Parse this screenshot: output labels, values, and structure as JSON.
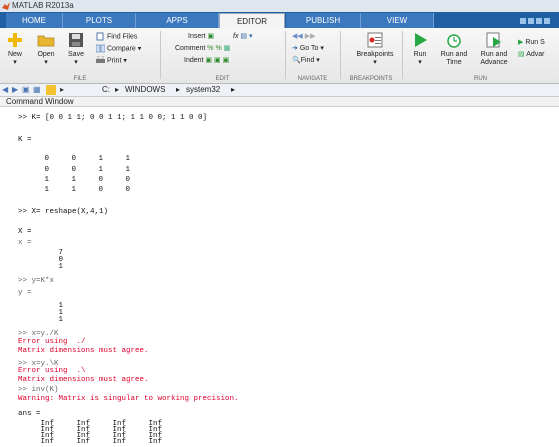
{
  "window": {
    "title": "MATLAB R2013a"
  },
  "tabs": [
    {
      "label": "HOME"
    },
    {
      "label": "PLOTS"
    },
    {
      "label": "APPS"
    },
    {
      "label": "EDITOR"
    },
    {
      "label": "PUBLISH"
    },
    {
      "label": "VIEW"
    }
  ],
  "ribbon": {
    "file": {
      "label": "FILE",
      "new": "New",
      "open": "Open",
      "save": "Save",
      "find_files": "Find Files",
      "compare": "Compare",
      "print": "Print"
    },
    "edit": {
      "label": "EDIT",
      "insert": "Insert",
      "comment": "Comment",
      "indent": "Indent",
      "fx": "fx"
    },
    "navigate": {
      "label": "NAVIGATE",
      "goto": "Go To",
      "find": "Find"
    },
    "breakpoints": {
      "label": "BREAKPOINTS",
      "button": "Breakpoints"
    },
    "run": {
      "label": "RUN",
      "run": "Run",
      "run_time": "Run and Time",
      "run_advance": "Run and Advance",
      "run_section": "Run S",
      "advance": "Advar"
    }
  },
  "path": {
    "drive": "C:",
    "folder1": "WINDOWS",
    "folder2": "system32",
    "sep": "▸"
  },
  "command_window": {
    "title": "Command Window",
    "lines": [
      ">> K= [0 0 1 1; 0 0 1 1; 1 1 0 0; 1 1 0 0]",
      "K =",
      "     0     0     1     1",
      "     0     0     1     1",
      "     1     1     0     0",
      "     1     1     0     0",
      ">> X= reshape(X,4,1)",
      "X =",
      "x =",
      "         7",
      "         0",
      "         1",
      ">> y=K*x",
      "y =",
      "         1",
      "         1",
      "         1",
      ">> x=y./K",
      "Error using  ./",
      "Matrix dimensions must agree.",
      ">> x=y.\\K",
      "Error using  .\\",
      "Matrix dimensions must agree.",
      ">> inv(K)",
      "Warning: Matrix is singular to working precision.",
      "ans =",
      "     Inf     Inf     Inf     Inf",
      "     Inf     Inf     Inf     Inf",
      "     Inf     Inf     Inf     Inf",
      "     Inf     Inf     Inf     Inf"
    ]
  },
  "colors": {
    "accent": "#1f5fa3",
    "error": "#e0002a"
  }
}
